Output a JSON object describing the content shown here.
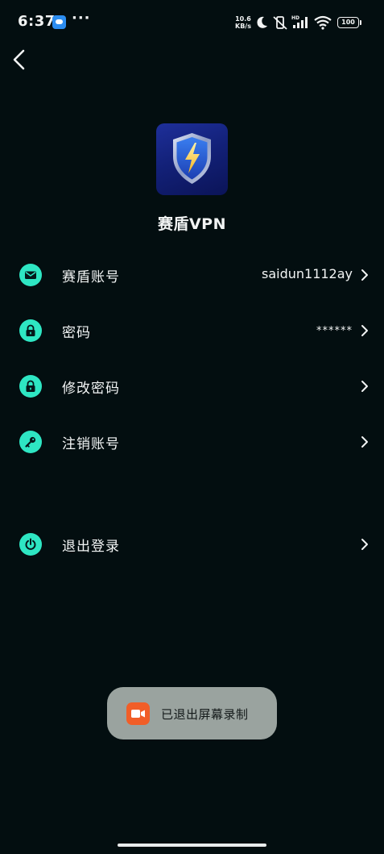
{
  "status_bar": {
    "time": "6:37",
    "more": "···",
    "net_speed_value": "10.6",
    "net_speed_unit": "KB/s",
    "battery": "100"
  },
  "app": {
    "name": "赛盾VPN"
  },
  "menu": {
    "account_label": "赛盾账号",
    "account_value": "saidun1112ay",
    "password_label": "密码",
    "password_value": "******",
    "change_password_label": "修改密码",
    "cancel_account_label": "注销账号",
    "logout_label": "退出登录"
  },
  "toast": {
    "text": "已退出屏幕录制"
  },
  "colors": {
    "background": "#030e10",
    "accent": "#2ee6c3",
    "toast_bg": "#9aa39f",
    "record_icon": "#f15e28"
  }
}
